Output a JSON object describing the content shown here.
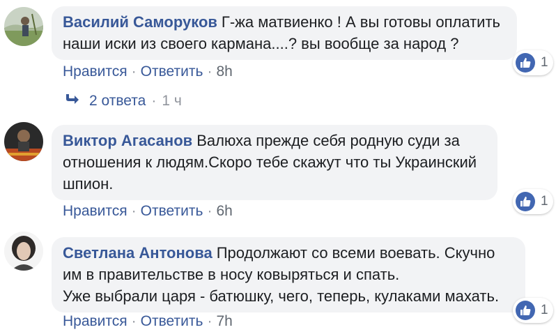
{
  "comments": [
    {
      "author": "Василий Саморуков",
      "text": "Г-жа матвиенко ! А вы готовы оплатить наши иски из своего кармана....? вы вообще за народ ?",
      "like_label": "Нравится",
      "reply_label": "Ответить",
      "time": "8h",
      "likes": "1",
      "replies": {
        "label": "2 ответа",
        "time": "1 ч"
      }
    },
    {
      "author": "Виктор Агасанов",
      "text": "Валюха прежде себя родную суди за отношения к людям.Скоро тебе скажут что ты Украинский шпион.",
      "like_label": "Нравится",
      "reply_label": "Ответить",
      "time": "6h",
      "likes": "1"
    },
    {
      "author": "Светлана Антонова",
      "text_lines": [
        "Продолжают со всеми воевать. Скучно им в правительстве в носу ковыряться и спать.",
        "Уже выбрали царя - батюшку, чего, теперь, кулаками махать."
      ],
      "like_label": "Нравится",
      "reply_label": "Ответить",
      "time": "7h",
      "likes": "1"
    }
  ],
  "colors": {
    "author": "#385898",
    "bubble": "#f2f3f5",
    "like_badge": "#4267b2",
    "meta": "#606770"
  },
  "icons": [
    "thumbs-up-icon",
    "reply-arrow-icon"
  ]
}
